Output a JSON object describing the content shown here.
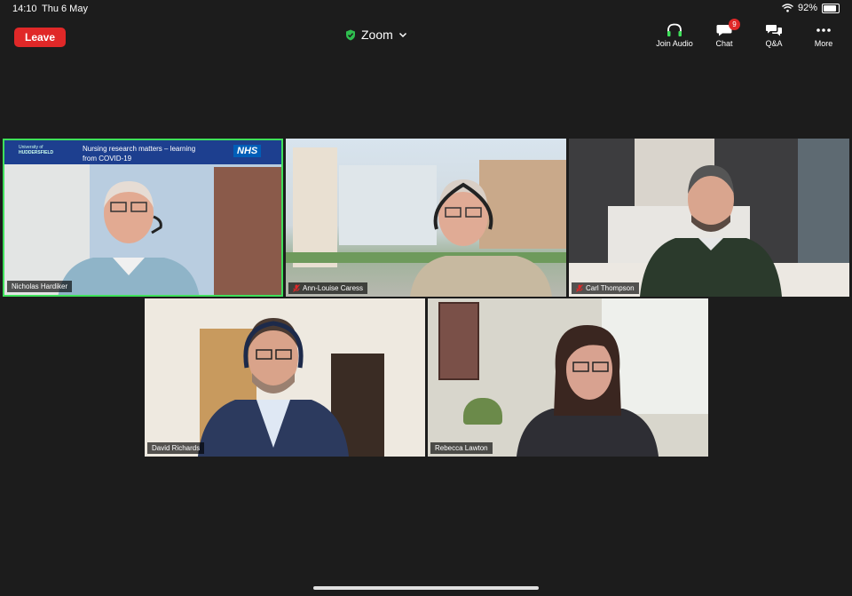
{
  "status_bar": {
    "time": "14:10",
    "date": "Thu 6 May",
    "battery": "92%"
  },
  "header": {
    "leave_label": "Leave",
    "title": "Zoom",
    "actions": [
      {
        "label": "Join Audio",
        "icon": "headphones-icon"
      },
      {
        "label": "Chat",
        "icon": "chat-icon",
        "badge": "9"
      },
      {
        "label": "Q&A",
        "icon": "qa-icon"
      },
      {
        "label": "More",
        "icon": "more-icon"
      }
    ]
  },
  "slide": {
    "logo_line1": "University of",
    "logo_line2": "HUDDERSFIELD",
    "title_line1": "Nursing research matters – learning",
    "title_line2": "from COVID-19",
    "nhs": "NHS"
  },
  "participants": [
    {
      "name": "Nicholas Hardiker",
      "muted": false,
      "active": true
    },
    {
      "name": "Ann-Louise Caress",
      "muted": true,
      "active": false
    },
    {
      "name": "Carl Thompson",
      "muted": true,
      "active": false
    },
    {
      "name": "David Richards",
      "muted": false,
      "active": false
    },
    {
      "name": "Rebecca Lawton",
      "muted": false,
      "active": false
    }
  ],
  "colors": {
    "leave": "#e02828",
    "active_border": "#3ee05a",
    "shield": "#2fbf4f",
    "muted": "#e02828"
  }
}
